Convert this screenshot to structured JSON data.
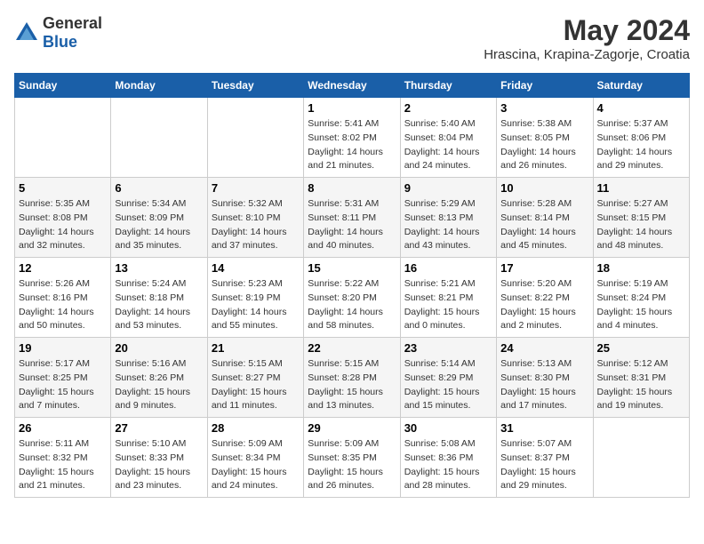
{
  "header": {
    "logo_general": "General",
    "logo_blue": "Blue",
    "title": "May 2024",
    "location": "Hrascina, Krapina-Zagorje, Croatia"
  },
  "days_of_week": [
    "Sunday",
    "Monday",
    "Tuesday",
    "Wednesday",
    "Thursday",
    "Friday",
    "Saturday"
  ],
  "weeks": [
    [
      {
        "num": "",
        "sunrise": "",
        "sunset": "",
        "daylight": ""
      },
      {
        "num": "",
        "sunrise": "",
        "sunset": "",
        "daylight": ""
      },
      {
        "num": "",
        "sunrise": "",
        "sunset": "",
        "daylight": ""
      },
      {
        "num": "1",
        "sunrise": "Sunrise: 5:41 AM",
        "sunset": "Sunset: 8:02 PM",
        "daylight": "Daylight: 14 hours and 21 minutes."
      },
      {
        "num": "2",
        "sunrise": "Sunrise: 5:40 AM",
        "sunset": "Sunset: 8:04 PM",
        "daylight": "Daylight: 14 hours and 24 minutes."
      },
      {
        "num": "3",
        "sunrise": "Sunrise: 5:38 AM",
        "sunset": "Sunset: 8:05 PM",
        "daylight": "Daylight: 14 hours and 26 minutes."
      },
      {
        "num": "4",
        "sunrise": "Sunrise: 5:37 AM",
        "sunset": "Sunset: 8:06 PM",
        "daylight": "Daylight: 14 hours and 29 minutes."
      }
    ],
    [
      {
        "num": "5",
        "sunrise": "Sunrise: 5:35 AM",
        "sunset": "Sunset: 8:08 PM",
        "daylight": "Daylight: 14 hours and 32 minutes."
      },
      {
        "num": "6",
        "sunrise": "Sunrise: 5:34 AM",
        "sunset": "Sunset: 8:09 PM",
        "daylight": "Daylight: 14 hours and 35 minutes."
      },
      {
        "num": "7",
        "sunrise": "Sunrise: 5:32 AM",
        "sunset": "Sunset: 8:10 PM",
        "daylight": "Daylight: 14 hours and 37 minutes."
      },
      {
        "num": "8",
        "sunrise": "Sunrise: 5:31 AM",
        "sunset": "Sunset: 8:11 PM",
        "daylight": "Daylight: 14 hours and 40 minutes."
      },
      {
        "num": "9",
        "sunrise": "Sunrise: 5:29 AM",
        "sunset": "Sunset: 8:13 PM",
        "daylight": "Daylight: 14 hours and 43 minutes."
      },
      {
        "num": "10",
        "sunrise": "Sunrise: 5:28 AM",
        "sunset": "Sunset: 8:14 PM",
        "daylight": "Daylight: 14 hours and 45 minutes."
      },
      {
        "num": "11",
        "sunrise": "Sunrise: 5:27 AM",
        "sunset": "Sunset: 8:15 PM",
        "daylight": "Daylight: 14 hours and 48 minutes."
      }
    ],
    [
      {
        "num": "12",
        "sunrise": "Sunrise: 5:26 AM",
        "sunset": "Sunset: 8:16 PM",
        "daylight": "Daylight: 14 hours and 50 minutes."
      },
      {
        "num": "13",
        "sunrise": "Sunrise: 5:24 AM",
        "sunset": "Sunset: 8:18 PM",
        "daylight": "Daylight: 14 hours and 53 minutes."
      },
      {
        "num": "14",
        "sunrise": "Sunrise: 5:23 AM",
        "sunset": "Sunset: 8:19 PM",
        "daylight": "Daylight: 14 hours and 55 minutes."
      },
      {
        "num": "15",
        "sunrise": "Sunrise: 5:22 AM",
        "sunset": "Sunset: 8:20 PM",
        "daylight": "Daylight: 14 hours and 58 minutes."
      },
      {
        "num": "16",
        "sunrise": "Sunrise: 5:21 AM",
        "sunset": "Sunset: 8:21 PM",
        "daylight": "Daylight: 15 hours and 0 minutes."
      },
      {
        "num": "17",
        "sunrise": "Sunrise: 5:20 AM",
        "sunset": "Sunset: 8:22 PM",
        "daylight": "Daylight: 15 hours and 2 minutes."
      },
      {
        "num": "18",
        "sunrise": "Sunrise: 5:19 AM",
        "sunset": "Sunset: 8:24 PM",
        "daylight": "Daylight: 15 hours and 4 minutes."
      }
    ],
    [
      {
        "num": "19",
        "sunrise": "Sunrise: 5:17 AM",
        "sunset": "Sunset: 8:25 PM",
        "daylight": "Daylight: 15 hours and 7 minutes."
      },
      {
        "num": "20",
        "sunrise": "Sunrise: 5:16 AM",
        "sunset": "Sunset: 8:26 PM",
        "daylight": "Daylight: 15 hours and 9 minutes."
      },
      {
        "num": "21",
        "sunrise": "Sunrise: 5:15 AM",
        "sunset": "Sunset: 8:27 PM",
        "daylight": "Daylight: 15 hours and 11 minutes."
      },
      {
        "num": "22",
        "sunrise": "Sunrise: 5:15 AM",
        "sunset": "Sunset: 8:28 PM",
        "daylight": "Daylight: 15 hours and 13 minutes."
      },
      {
        "num": "23",
        "sunrise": "Sunrise: 5:14 AM",
        "sunset": "Sunset: 8:29 PM",
        "daylight": "Daylight: 15 hours and 15 minutes."
      },
      {
        "num": "24",
        "sunrise": "Sunrise: 5:13 AM",
        "sunset": "Sunset: 8:30 PM",
        "daylight": "Daylight: 15 hours and 17 minutes."
      },
      {
        "num": "25",
        "sunrise": "Sunrise: 5:12 AM",
        "sunset": "Sunset: 8:31 PM",
        "daylight": "Daylight: 15 hours and 19 minutes."
      }
    ],
    [
      {
        "num": "26",
        "sunrise": "Sunrise: 5:11 AM",
        "sunset": "Sunset: 8:32 PM",
        "daylight": "Daylight: 15 hours and 21 minutes."
      },
      {
        "num": "27",
        "sunrise": "Sunrise: 5:10 AM",
        "sunset": "Sunset: 8:33 PM",
        "daylight": "Daylight: 15 hours and 23 minutes."
      },
      {
        "num": "28",
        "sunrise": "Sunrise: 5:09 AM",
        "sunset": "Sunset: 8:34 PM",
        "daylight": "Daylight: 15 hours and 24 minutes."
      },
      {
        "num": "29",
        "sunrise": "Sunrise: 5:09 AM",
        "sunset": "Sunset: 8:35 PM",
        "daylight": "Daylight: 15 hours and 26 minutes."
      },
      {
        "num": "30",
        "sunrise": "Sunrise: 5:08 AM",
        "sunset": "Sunset: 8:36 PM",
        "daylight": "Daylight: 15 hours and 28 minutes."
      },
      {
        "num": "31",
        "sunrise": "Sunrise: 5:07 AM",
        "sunset": "Sunset: 8:37 PM",
        "daylight": "Daylight: 15 hours and 29 minutes."
      },
      {
        "num": "",
        "sunrise": "",
        "sunset": "",
        "daylight": ""
      }
    ]
  ]
}
